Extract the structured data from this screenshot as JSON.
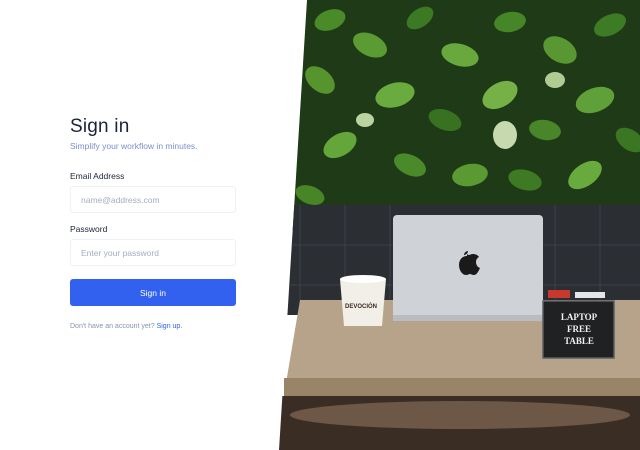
{
  "form": {
    "title": "Sign in",
    "subtitle": "Simplify your workflow in minutes.",
    "email_label": "Email Address",
    "email_placeholder": "name@address.com",
    "password_label": "Password",
    "password_placeholder": "Enter your password",
    "submit_label": "Sign in",
    "signup_prompt": "Don't have an account yet?",
    "signup_link": "Sign up."
  },
  "photo": {
    "cup_text": "DEVOCIÓN",
    "sign_lines": [
      "LAPTOP",
      "FREE",
      "TABLE"
    ]
  },
  "colors": {
    "accent": "#3261f0",
    "title": "#1b2437",
    "subtitle": "#7a90c9"
  }
}
